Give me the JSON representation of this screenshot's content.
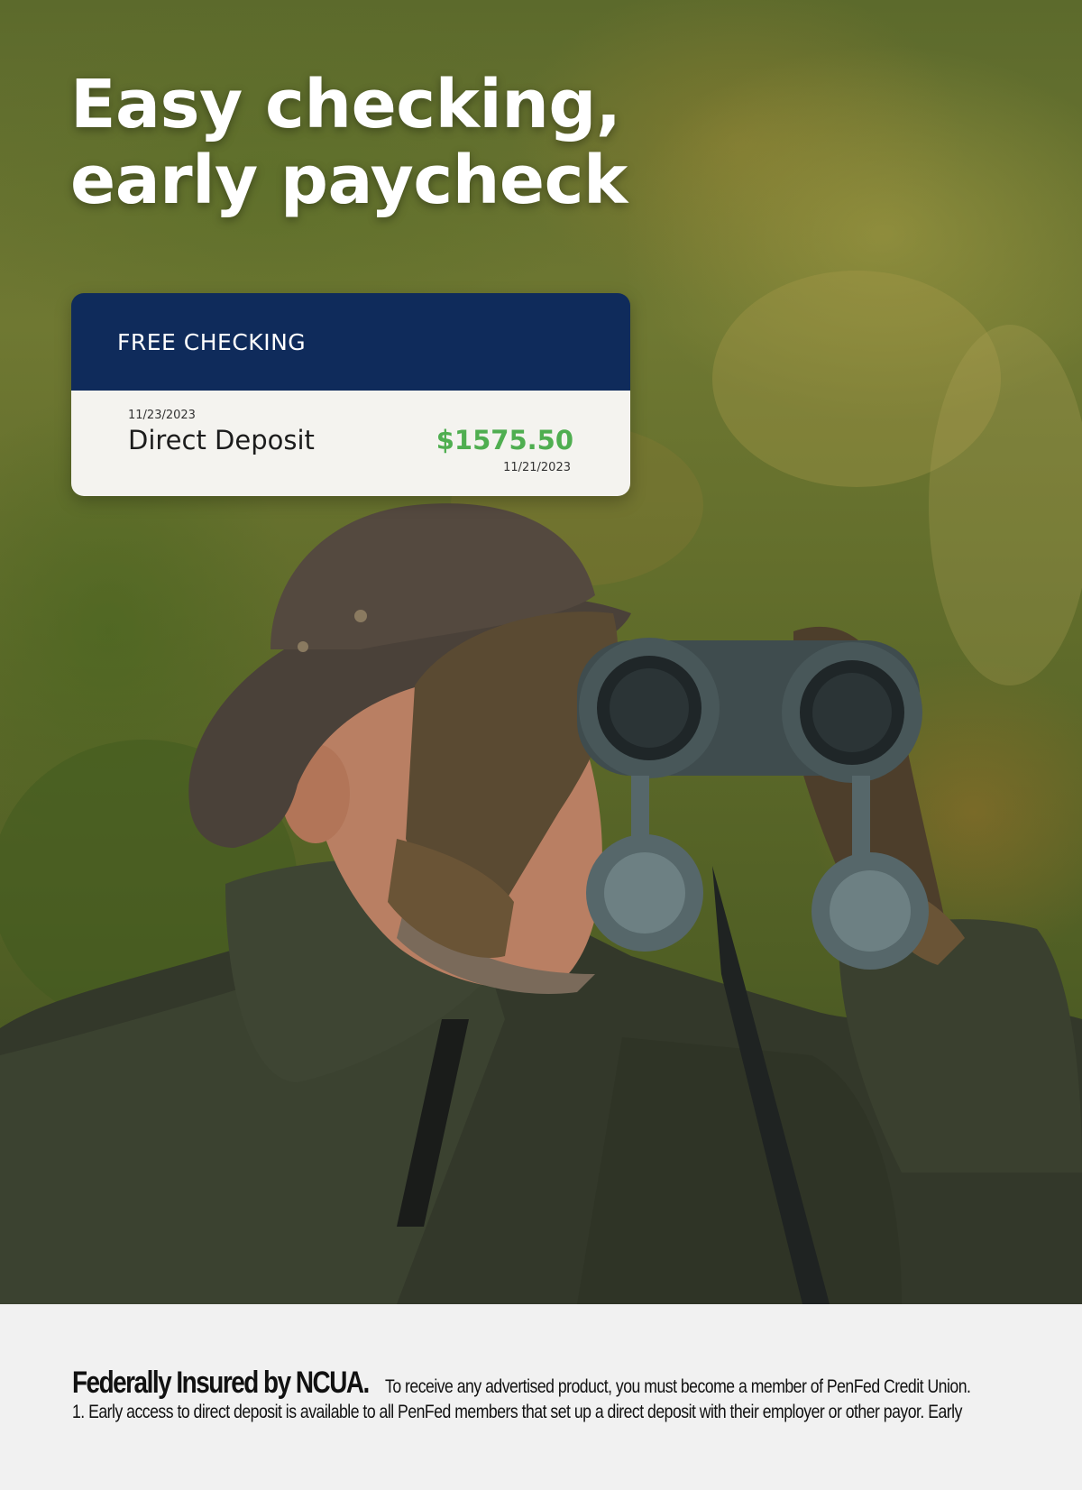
{
  "headline": {
    "line1": "Easy checking,",
    "line2": "early paycheck"
  },
  "card": {
    "account_label": "FREE CHECKING",
    "transaction": {
      "posted_date": "11/23/2023",
      "description": "Direct Deposit",
      "amount": "$1575.50",
      "early_date": "11/21/2023"
    },
    "colors": {
      "header": "#0f2b5b",
      "amount": "#4fae50"
    }
  },
  "hero_image": {
    "icon": "man-with-binoculars-photo"
  },
  "footer": {
    "ncua_statement": "Federally Insured by NCUA.",
    "membership_note": "To receive any advertised product, you must become a member of PenFed Credit Union.",
    "disclosure_1": "1. Early access to direct deposit is available to all PenFed members that set up a direct deposit with their employer or other payor. Early"
  }
}
